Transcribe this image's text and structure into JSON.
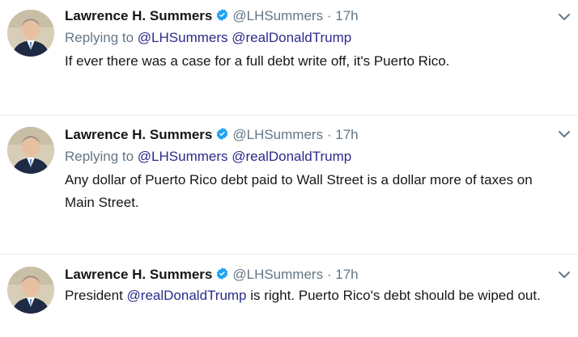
{
  "tweets": [
    {
      "fullname": "Lawrence H. Summers",
      "handle": "@LHSummers",
      "separator": "·",
      "time": "17h",
      "reply_prefix": "Replying to",
      "reply_mentions": [
        "@LHSummers",
        "@realDonaldTrump"
      ],
      "text_parts": [
        "If ever there was a case for a full debt write off, it's Puerto Rico."
      ]
    },
    {
      "fullname": "Lawrence H. Summers",
      "handle": "@LHSummers",
      "separator": "·",
      "time": "17h",
      "reply_prefix": "Replying to",
      "reply_mentions": [
        "@LHSummers",
        "@realDonaldTrump"
      ],
      "text_parts": [
        "Any dollar of Puerto Rico debt paid to Wall Street is a dollar more of taxes on Main Street."
      ]
    },
    {
      "fullname": "Lawrence H. Summers",
      "handle": "@LHSummers",
      "separator": "·",
      "time": "17h",
      "text_parts": [
        "President ",
        "@realDonaldTrump",
        " is right. Puerto Rico's debt should be wiped out."
      ]
    }
  ],
  "icons": {
    "verified": "verified-badge-icon",
    "caret": "chevron-down-icon"
  },
  "colors": {
    "verified_blue": "#1da1f2",
    "mention": "#2b2a8c",
    "meta_gray": "#657786",
    "text": "#14171a",
    "divider": "#e6ecf0"
  }
}
